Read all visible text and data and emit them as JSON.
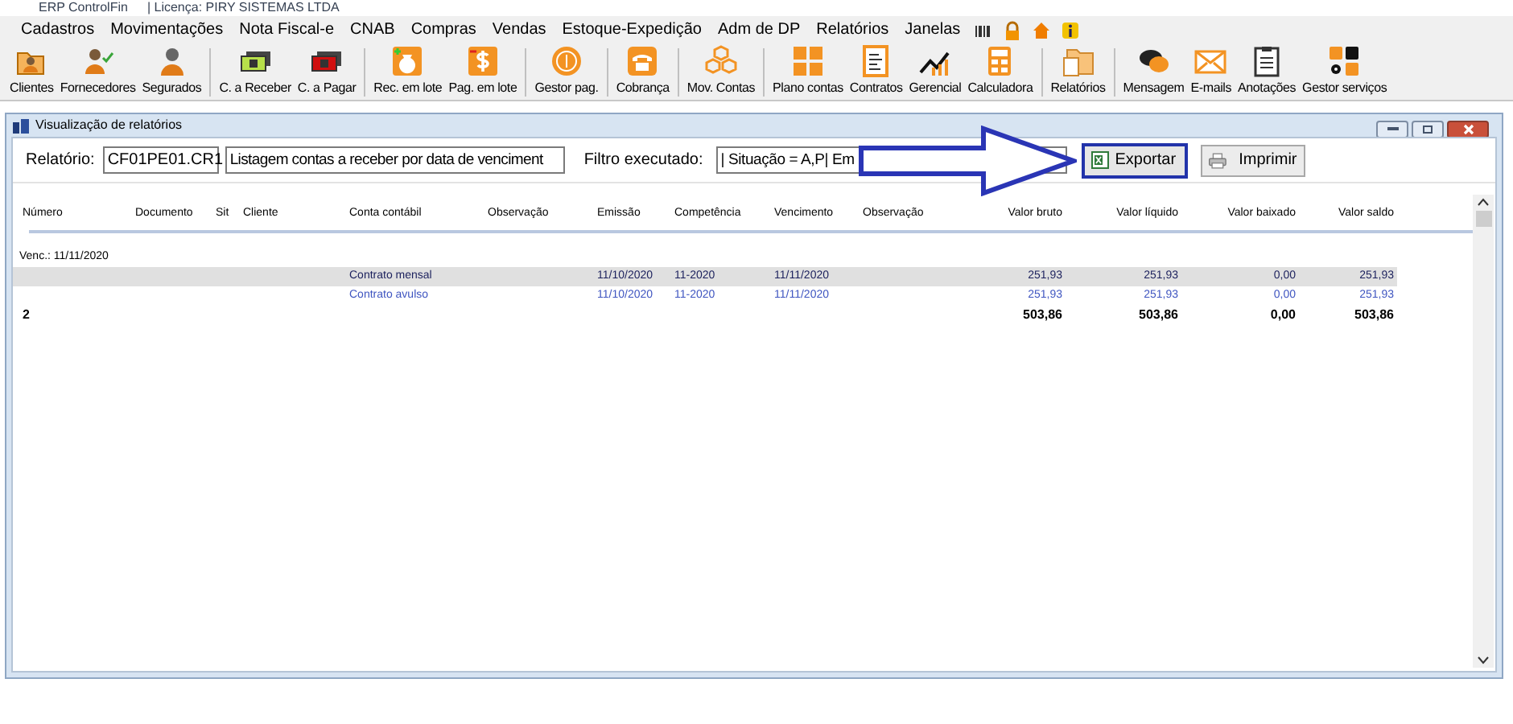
{
  "app_title": {
    "name": "ERP ControlFin",
    "license": "| Licença: PIRY SISTEMAS LTDA"
  },
  "menu": [
    "Cadastros",
    "Movimentações",
    "Nota Fiscal-e",
    "CNAB",
    "Compras",
    "Vendas",
    "Estoque-Expedição",
    "Adm de DP",
    "Relatórios",
    "Janelas"
  ],
  "toolbar": [
    [
      "Clientes",
      "Fornecedores",
      "Segurados"
    ],
    [
      "C. a Receber",
      "C. a Pagar"
    ],
    [
      "Rec. em lote",
      "Pag. em lote"
    ],
    [
      "Gestor pag."
    ],
    [
      "Cobrança"
    ],
    [
      "Mov. Contas"
    ],
    [
      "Plano contas",
      "Contratos",
      "Gerencial",
      "Calculadora"
    ],
    [
      "Relatórios"
    ],
    [
      "Mensagem",
      "E-mails",
      "Anotações",
      "Gestor serviços"
    ]
  ],
  "report_window": {
    "title": "Visualização de relatórios",
    "report_label": "Relatório:",
    "report_code": "CF01PE01.CR1",
    "report_name": "Listagem contas a receber por data de venciment",
    "filter_label": "Filtro executado:",
    "filter_value": "| Situação = A,P| Em",
    "export_button": "Exportar",
    "print_button": "Imprimir",
    "columns": [
      "Número",
      "Documento",
      "Sit",
      "Cliente",
      "Conta contábil",
      "Observação",
      "Emissão",
      "Competência",
      "Vencimento",
      "Observação",
      "Valor bruto",
      "Valor líquido",
      "Valor baixado",
      "Valor saldo"
    ],
    "group": "Venc.: 11/11/2020",
    "rows": [
      {
        "selected": true,
        "conta_contabil": "Contrato mensal",
        "emissao": "11/10/2020",
        "competencia": "11-2020",
        "vencimento": "11/11/2020",
        "valor_bruto": "251,93",
        "valor_liquido": "251,93",
        "valor_baixado": "0,00",
        "valor_saldo": "251,93"
      },
      {
        "selected": false,
        "conta_contabil": "Contrato avulso",
        "emissao": "11/10/2020",
        "competencia": "11-2020",
        "vencimento": "11/11/2020",
        "valor_bruto": "251,93",
        "valor_liquido": "251,93",
        "valor_baixado": "0,00",
        "valor_saldo": "251,93"
      }
    ],
    "total": {
      "count": "2",
      "valor_bruto": "503,86",
      "valor_liquido": "503,86",
      "valor_baixado": "0,00",
      "valor_saldo": "503,86"
    }
  }
}
